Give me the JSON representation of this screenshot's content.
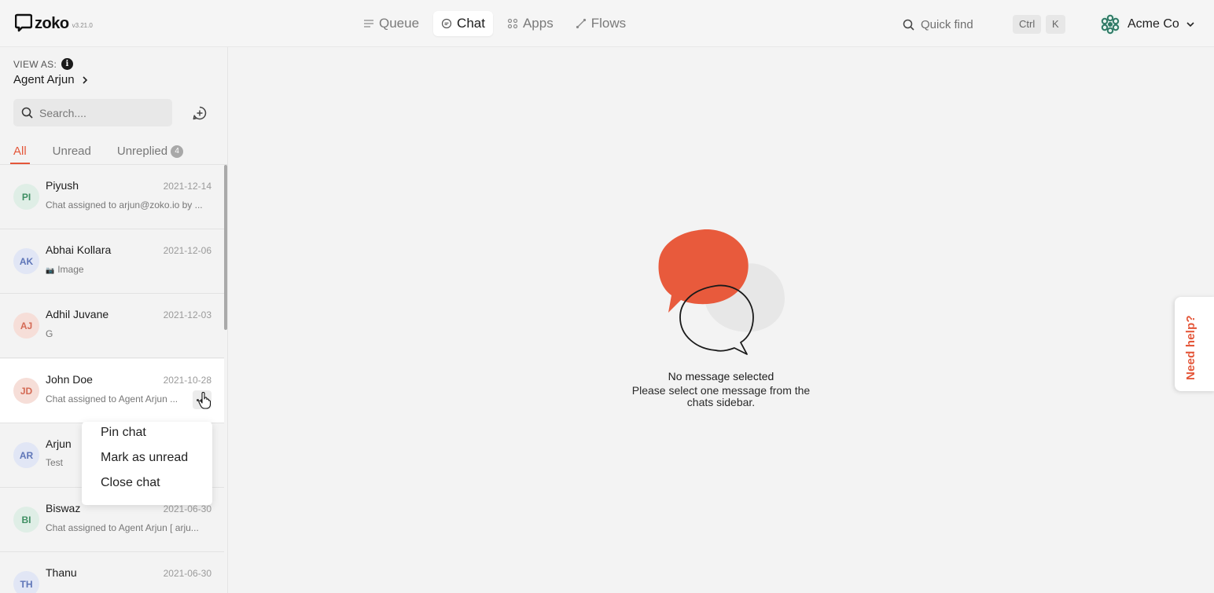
{
  "app": {
    "name": "zoko",
    "version": "v3.21.0"
  },
  "nav": {
    "items": [
      {
        "label": "Queue",
        "icon": "queue-icon"
      },
      {
        "label": "Chat",
        "icon": "chat-icon",
        "active": true
      },
      {
        "label": "Apps",
        "icon": "apps-icon"
      },
      {
        "label": "Flows",
        "icon": "flows-icon"
      }
    ]
  },
  "quickfind": {
    "label": "Quick find",
    "key1": "Ctrl",
    "key2": "K"
  },
  "account": {
    "name": "Acme Co"
  },
  "sidebar": {
    "view_as_label": "VIEW AS:",
    "view_as_agent": "Agent Arjun",
    "search_placeholder": "Search....",
    "tabs": [
      {
        "label": "All",
        "active": true
      },
      {
        "label": "Unread"
      },
      {
        "label": "Unreplied",
        "badge": "4"
      }
    ],
    "chats": [
      {
        "initials": "PI",
        "name": "Piyush",
        "date": "2021-12-14",
        "preview": "Chat assigned to arjun@zoko.io by ...",
        "avatar_bg": "#dfeee6",
        "avatar_fg": "#3f8f63"
      },
      {
        "initials": "AK",
        "name": "Abhai Kollara",
        "date": "2021-12-06",
        "preview": "Image",
        "preview_icon": "camera-icon",
        "avatar_bg": "#e1e6f5",
        "avatar_fg": "#5f76b8"
      },
      {
        "initials": "AJ",
        "name": "Adhil Juvane",
        "date": "2021-12-03",
        "preview": "G",
        "avatar_bg": "#f6ded8",
        "avatar_fg": "#d46a55"
      },
      {
        "initials": "JD",
        "name": "John Doe",
        "date": "2021-10-28",
        "preview": "Chat assigned to Agent Arjun ...",
        "avatar_bg": "#f6ded8",
        "avatar_fg": "#d46a55"
      },
      {
        "initials": "AR",
        "name": "Arjun",
        "date": "",
        "preview": "Test",
        "avatar_bg": "#e1e6f5",
        "avatar_fg": "#5f76b8"
      },
      {
        "initials": "BI",
        "name": "Biswaz",
        "date": "2021-06-30",
        "preview": "Chat assigned to Agent Arjun [ arju...",
        "avatar_bg": "#dfeee6",
        "avatar_fg": "#3f8f63"
      },
      {
        "initials": "TH",
        "name": "Thanu",
        "date": "2021-06-30",
        "preview": "",
        "avatar_bg": "#e1e6f5",
        "avatar_fg": "#5f76b8"
      }
    ]
  },
  "context_menu": {
    "items": [
      "Pin chat",
      "Mark as unread",
      "Close chat"
    ]
  },
  "empty_state": {
    "title": "No message selected",
    "text": "Please select one message from the chats sidebar."
  },
  "help": {
    "label": "Need help?"
  },
  "colors": {
    "accent": "#e4573a",
    "bubble": "#e85a3c"
  }
}
